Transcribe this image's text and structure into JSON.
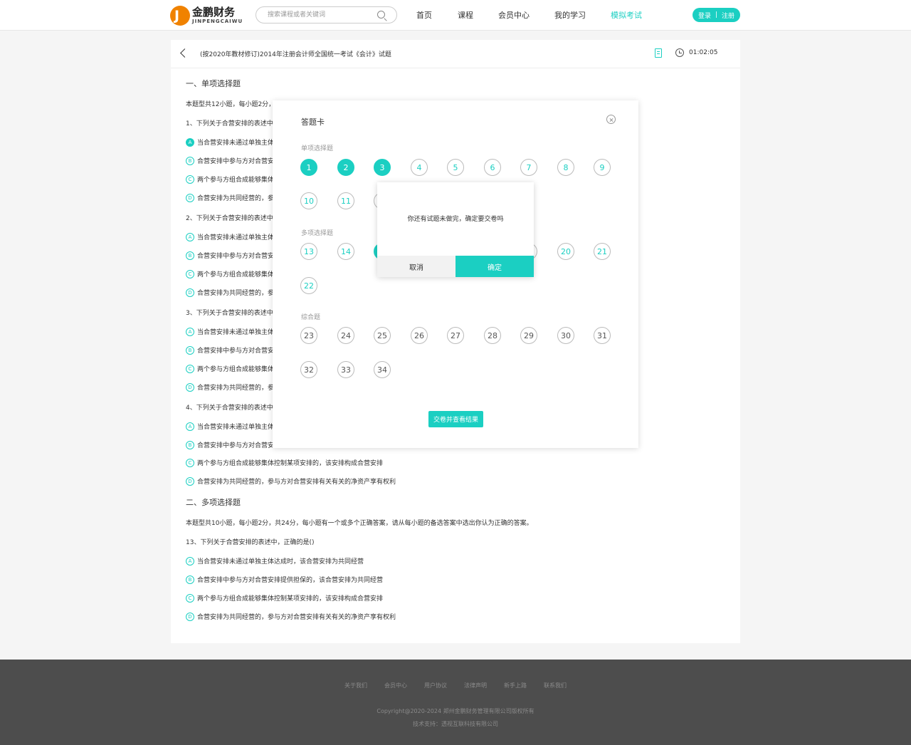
{
  "header": {
    "logo_cn": "金鹏财务",
    "logo_en": "JINPENGCAIWU",
    "search_placeholder": "搜索课程或者关键词",
    "nav": [
      "首页",
      "课程",
      "会员中心",
      "我的学习",
      "模拟考试"
    ],
    "login": "登录",
    "separator": "|",
    "register": "注册"
  },
  "exam": {
    "title": "(按2020年教材修订)2014年注册会计师全国统一考试《会计》试题",
    "timer": "01:02:05"
  },
  "content": {
    "section1_title": "一、单项选择题",
    "section1_desc": "本题型共12小题，每小题2分，",
    "questions": [
      {
        "stem": "1、下列关于合营安排的表述中",
        "options": [
          "当合营安排未通过单独主体",
          "合营安排中参与方对合营安",
          "两个参与方组合成能够集体",
          "合营安排为共同经营的，参"
        ]
      },
      {
        "stem": "2、下列关于合营安排的表述中",
        "options": [
          "当合营安排未通过单独主体",
          "合营安排中参与方对合营安",
          "两个参与方组合成能够集体",
          "合营安排为共同经营的，参"
        ]
      },
      {
        "stem": "3、下列关于合营安排的表述中",
        "options": [
          "当合营安排未通过单独主体",
          "合营安排中参与方对合营安",
          "两个参与方组合成能够集体",
          "合营安排为共同经营的，参"
        ]
      },
      {
        "stem": "4、下列关于合营安排的表述中",
        "options": [
          "当合营安排未通过单独主体",
          "合营安排中参与方对合营安",
          "两个参与方组合成能够集体控制某项安排的，该安排构成合营安排",
          "合营安排为共同经营的，参与方对合营安排有关有关的净资产享有权利"
        ]
      }
    ],
    "option_letters": [
      "A",
      "B",
      "C",
      "D"
    ],
    "section2_title": "二、多项选择题",
    "section2_desc": "本题型共10小题，每小题2分，共24分，每小题有一个或多个正确答案，请从每小题的备选答案中选出你认为正确的答案。",
    "q13": {
      "stem": "13、下列关于合营安排的表述中，正确的是()",
      "options": [
        "当合营安排未通过单独主体达成时，该合营安排为共同经营",
        "合营安排中参与方对合营安排提供担保的，该合营安排为共同经营",
        "两个参与方组合成能够集体控制某项安排的，该安排构成合营安排",
        "合营安排为共同经营的，参与方对合营安排有关有关的净资产享有权利"
      ]
    }
  },
  "answer_card": {
    "title": "答题卡",
    "group1": "单项选择题",
    "group2": "多项选择题",
    "group3": "综合题",
    "row1": [
      "1",
      "2",
      "3",
      "4",
      "5",
      "6",
      "7",
      "8",
      "9"
    ],
    "row2": [
      "10",
      "11"
    ],
    "row3": [
      "13",
      "14"
    ],
    "row3_right": [
      "20",
      "21"
    ],
    "row4": [
      "22"
    ],
    "row5": [
      "23",
      "24",
      "25",
      "26",
      "27",
      "28",
      "29",
      "30",
      "31"
    ],
    "row6": [
      "32",
      "33",
      "34"
    ],
    "submit": "交卷并查看结果"
  },
  "confirm": {
    "message": "你还有试题未做完，确定要交卷吗",
    "cancel": "取消",
    "ok": "确定"
  },
  "footer": {
    "links": [
      "关于我们",
      "会员中心",
      "用户协议",
      "法律声明",
      "新手上路",
      "联系我们"
    ],
    "copyright": "Copyright@2020-2024 郑州金鹏财务管理有限公司版权所有",
    "support": "技术支持：透视互联科技有限公司"
  },
  "colors": {
    "accent": "#1bcfc2",
    "logo": "#f08200",
    "footer": "#4d4d4d"
  }
}
